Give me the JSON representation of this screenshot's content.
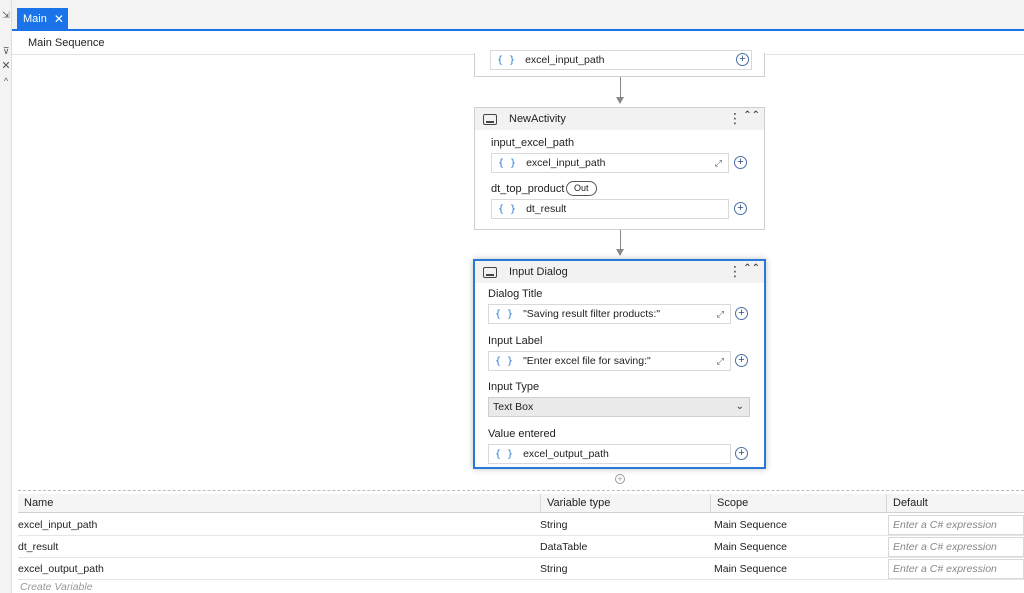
{
  "gutter": {
    "icon_top": "⇲",
    "icon_mid": "⊽",
    "icon_close": "✕",
    "icon_up": "^"
  },
  "tabs": [
    {
      "label": "Main",
      "close": "✕"
    }
  ],
  "breadcrumb": "Main Sequence",
  "top_activity": {
    "value": "excel_input_path"
  },
  "new_activity": {
    "title": "NewActivity",
    "fields": [
      {
        "label": "input_excel_path",
        "value": "excel_input_path"
      },
      {
        "label": "dt_top_product",
        "badge": "Out",
        "value": "dt_result"
      }
    ]
  },
  "input_dialog": {
    "title": "Input Dialog",
    "dialog_title_label": "Dialog Title",
    "dialog_title_value": "\"Saving result filter products:\"",
    "input_label_label": "Input Label",
    "input_label_value": "\"Enter excel file for saving:\"",
    "input_type_label": "Input Type",
    "input_type_value": "Text Box",
    "value_entered_label": "Value entered",
    "value_entered_value": "excel_output_path"
  },
  "glyphs": {
    "brace": "{ }",
    "expand": "⤢",
    "plus": "+",
    "dots": "⋮",
    "collapse": "⌃⌃",
    "chevron": "⌄"
  },
  "variables": {
    "columns": [
      "Name",
      "Variable type",
      "Scope",
      "Default"
    ],
    "rows": [
      {
        "name": "excel_input_path",
        "type": "String",
        "scope": "Main Sequence",
        "default": "Enter a C# expression"
      },
      {
        "name": "dt_result",
        "type": "DataTable",
        "scope": "Main Sequence",
        "default": "Enter a C# expression"
      },
      {
        "name": "excel_output_path",
        "type": "String",
        "scope": "Main Sequence",
        "default": "Enter a C# expression"
      }
    ],
    "create_label": "Create Variable"
  },
  "colors": {
    "accent": "#1a73e8",
    "selected_border": "#2a78d6"
  }
}
